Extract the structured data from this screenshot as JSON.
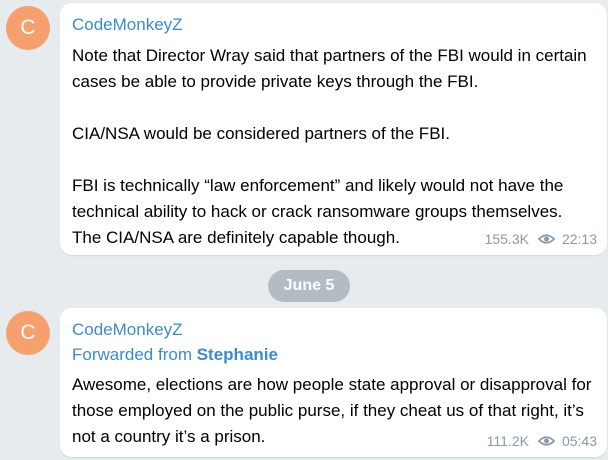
{
  "messages": [
    {
      "avatar_letter": "C",
      "sender": "CodeMonkeyZ",
      "paragraphs": [
        "Note that Director Wray said that partners of the FBI would in certain cases be able to provide private keys through the FBI.",
        "CIA/NSA would be considered partners of the FBI.",
        "FBI is technically “law enforcement” and likely would not have the technical ability to hack or crack ransomware groups themselves. The CIA/NSA are definitely capable though."
      ],
      "views": "155.3K",
      "time": "22:13"
    },
    {
      "avatar_letter": "C",
      "sender": "CodeMonkeyZ",
      "forwarded_prefix": "Forwarded from",
      "forwarded_from": "Stephanie",
      "paragraphs": [
        "Awesome, elections are how people state approval or disapproval for those employed on the public purse, if they cheat us of that right, it’s not a country it’s a prison."
      ],
      "views": "111.2K",
      "time": "05:43"
    }
  ],
  "date_separator": "June 5",
  "colors": {
    "background": "#e6ebee",
    "bubble": "#ffffff",
    "sender": "#3a8ccf",
    "avatar": "#f5a06d",
    "meta": "#8a9aa5",
    "date_pill": "#b4bcc3"
  },
  "icons": {
    "views": "eye-icon"
  }
}
